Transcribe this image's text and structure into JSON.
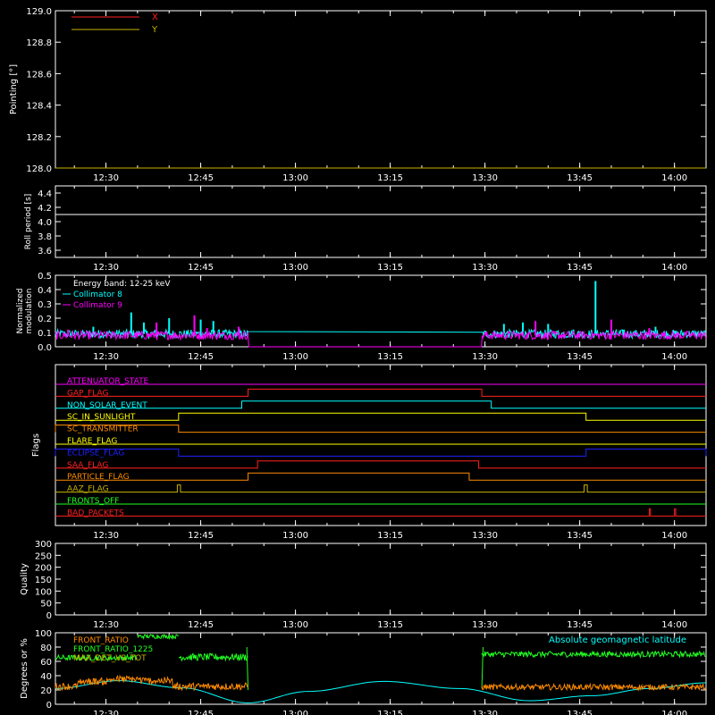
{
  "time_axis": {
    "ticks": [
      {
        "label": "12:30",
        "minutes": 30
      },
      {
        "label": "12:45",
        "minutes": 45
      },
      {
        "label": "13:00",
        "minutes": 60
      },
      {
        "label": "13:15",
        "minutes": 75
      },
      {
        "label": "13:30",
        "minutes": 90
      },
      {
        "label": "13:45",
        "minutes": 105
      },
      {
        "label": "14:00",
        "minutes": 120
      }
    ],
    "range_minutes": [
      22,
      125
    ],
    "minutes_from": "12:00"
  },
  "colors": {
    "background": "#000000",
    "axes": "#ffffff",
    "x": "#ff2020",
    "y": "#c8b400",
    "cyan": "#00ffff",
    "magenta": "#ff00ff",
    "green": "#22ff22",
    "orange": "#ff8c00"
  },
  "chart_data": [
    {
      "type": "line",
      "id": "pointing",
      "ylabel": "Pointing [°]",
      "ylim": [
        128.0,
        129.0
      ],
      "yticks": [
        "128.0",
        "128.2",
        "128.4",
        "128.6",
        "128.8",
        "129.0"
      ],
      "legend": [
        "X",
        "Y"
      ],
      "series": [
        {
          "name": "X",
          "color": "#ff2020",
          "x": [
            22,
            125
          ],
          "y": [
            128.0,
            128.0
          ]
        },
        {
          "name": "Y",
          "color": "#c8b400",
          "x": [
            22,
            125
          ],
          "y": [
            128.0,
            128.0
          ]
        }
      ]
    },
    {
      "type": "line",
      "id": "roll",
      "ylabel": "Roll period [s]",
      "ylim": [
        3.5,
        4.5
      ],
      "yticks": [
        "3.6",
        "3.8",
        "4.0",
        "4.2",
        "4.4"
      ],
      "series": [
        {
          "color": "#ffffff",
          "x": [
            22,
            125
          ],
          "y": [
            4.1,
            4.1
          ]
        }
      ]
    },
    {
      "type": "line",
      "id": "modulation",
      "ylabel": [
        "Normalized",
        "modulation"
      ],
      "ylim": [
        0,
        0.5
      ],
      "yticks": [
        "0.0",
        "0.1",
        "0.2",
        "0.3",
        "0.4",
        "0.5"
      ],
      "legend": [
        "Energy band: 12-25 keV",
        "Collimator 8",
        "Collimator 9"
      ],
      "series": [
        {
          "name": "Collimator 8",
          "color": "#00ffff",
          "segments": [
            [
              22,
              52.5
            ],
            [
              89.5,
              125
            ]
          ],
          "baseline": 0.09,
          "noise": 0.03,
          "spikes": [
            [
              28,
              0.14
            ],
            [
              34,
              0.24
            ],
            [
              36,
              0.17
            ],
            [
              40,
              0.2
            ],
            [
              45,
              0.19
            ],
            [
              47,
              0.18
            ],
            [
              93,
              0.16
            ],
            [
              96,
              0.17
            ],
            [
              100,
              0.16
            ],
            [
              104,
              0.12
            ],
            [
              107.5,
              0.46
            ],
            [
              112,
              0.12
            ],
            [
              117,
              0.14
            ]
          ]
        },
        {
          "name": "Collimator 9",
          "color": "#ff00ff",
          "segments": [
            [
              22,
              125
            ]
          ],
          "baseline": 0.08,
          "noise": 0.03,
          "gap": [
            52.5,
            89.5
          ],
          "gap_level": 0.0,
          "spikes": [
            [
              24,
              0.12
            ],
            [
              38,
              0.17
            ],
            [
              44,
              0.22
            ],
            [
              46,
              0.13
            ],
            [
              51,
              0.14
            ],
            [
              98,
              0.18
            ],
            [
              110,
              0.19
            ],
            [
              116,
              0.13
            ]
          ]
        }
      ]
    },
    {
      "type": "line",
      "id": "flags",
      "ylabel": "Flags",
      "flags": [
        {
          "name": "ATTENUATOR_STATE",
          "color": "#ff00ff",
          "highs": []
        },
        {
          "name": "GAP_FLAG",
          "color": "#ff2020",
          "highs": [
            [
              52.5,
              89.5
            ]
          ]
        },
        {
          "name": "NON_SOLAR_EVENT",
          "color": "#00ffff",
          "highs": [
            [
              51.5,
              91
            ]
          ]
        },
        {
          "name": "SC_IN_SUNLIGHT",
          "color": "#ffff00",
          "highs": [
            [
              41.5,
              106
            ]
          ]
        },
        {
          "name": "SC_TRANSMITTER",
          "color": "#ff8c00",
          "highs": [
            [
              22,
              41.5
            ]
          ]
        },
        {
          "name": "FLARE_FLAG",
          "color": "#ffff00",
          "highs": []
        },
        {
          "name": "ECLIPSE_FLAG",
          "color": "#2020ff",
          "highs": [
            [
              22,
              41.5
            ],
            [
              106,
              125
            ]
          ]
        },
        {
          "name": "SAA_FLAG",
          "color": "#ff2020",
          "highs": [
            [
              54,
              89
            ]
          ]
        },
        {
          "name": "PARTICLE_FLAG",
          "color": "#ff8c00",
          "highs": [
            [
              52.5,
              87.5
            ]
          ]
        },
        {
          "name": "AAZ_FLAG",
          "color": "#c8b400",
          "highs": [
            [
              41.3,
              41.8
            ],
            [
              105.7,
              106.2
            ]
          ]
        },
        {
          "name": "FRONTS_OFF",
          "color": "#22ff22",
          "highs": []
        },
        {
          "name": "BAD_PACKETS",
          "color": "#ff2020",
          "highs": [
            [
              116,
              116.2
            ],
            [
              120,
              120.2
            ]
          ]
        }
      ]
    },
    {
      "type": "line",
      "id": "quality",
      "ylabel": "Quality",
      "ylim": [
        0,
        300
      ],
      "yticks": [
        "0",
        "50",
        "100",
        "150",
        "200",
        "250",
        "300"
      ],
      "series": []
    },
    {
      "type": "line",
      "id": "fronts",
      "ylabel": "Degrees or %",
      "ylim": [
        0,
        100
      ],
      "yticks": [
        "0",
        "20",
        "40",
        "60",
        "80",
        "100"
      ],
      "legend": [
        "FRONT_RATIO",
        "FRONT_RATIO_1225",
        "MAX_DET_VS_TOT"
      ],
      "annotation": "Absolute geomagnetic latitude",
      "series": [
        {
          "name": "Absolute geomagnetic latitude",
          "color": "#00ffff",
          "x": [
            22,
            32,
            42,
            52.5,
            62,
            74,
            86,
            97,
            107,
            116,
            125
          ],
          "y": [
            22,
            33,
            23,
            2,
            18,
            32,
            22,
            5,
            12,
            22,
            30
          ]
        },
        {
          "name": "FRONT_RATIO_1225",
          "color": "#22ff22",
          "segments": [
            [
              22,
              35,
              65,
              4
            ],
            [
              35,
              41.5,
              95,
              3
            ],
            [
              41.5,
              52.5,
              66,
              5
            ],
            [
              89.5,
              125,
              70,
              4
            ]
          ],
          "edges": [
            [
              52.3,
              80
            ],
            [
              52.5,
              20
            ],
            [
              89.5,
              22
            ],
            [
              89.7,
              80
            ]
          ]
        },
        {
          "name": "FRONT_RATIO",
          "color": "#ff8c00",
          "segments": [
            [
              22,
              52.5,
              25,
              5
            ],
            [
              89.5,
              125,
              24,
              4
            ]
          ],
          "bumps": [
            [
              28,
              32
            ],
            [
              33,
              35
            ],
            [
              38,
              33
            ]
          ]
        }
      ]
    }
  ]
}
